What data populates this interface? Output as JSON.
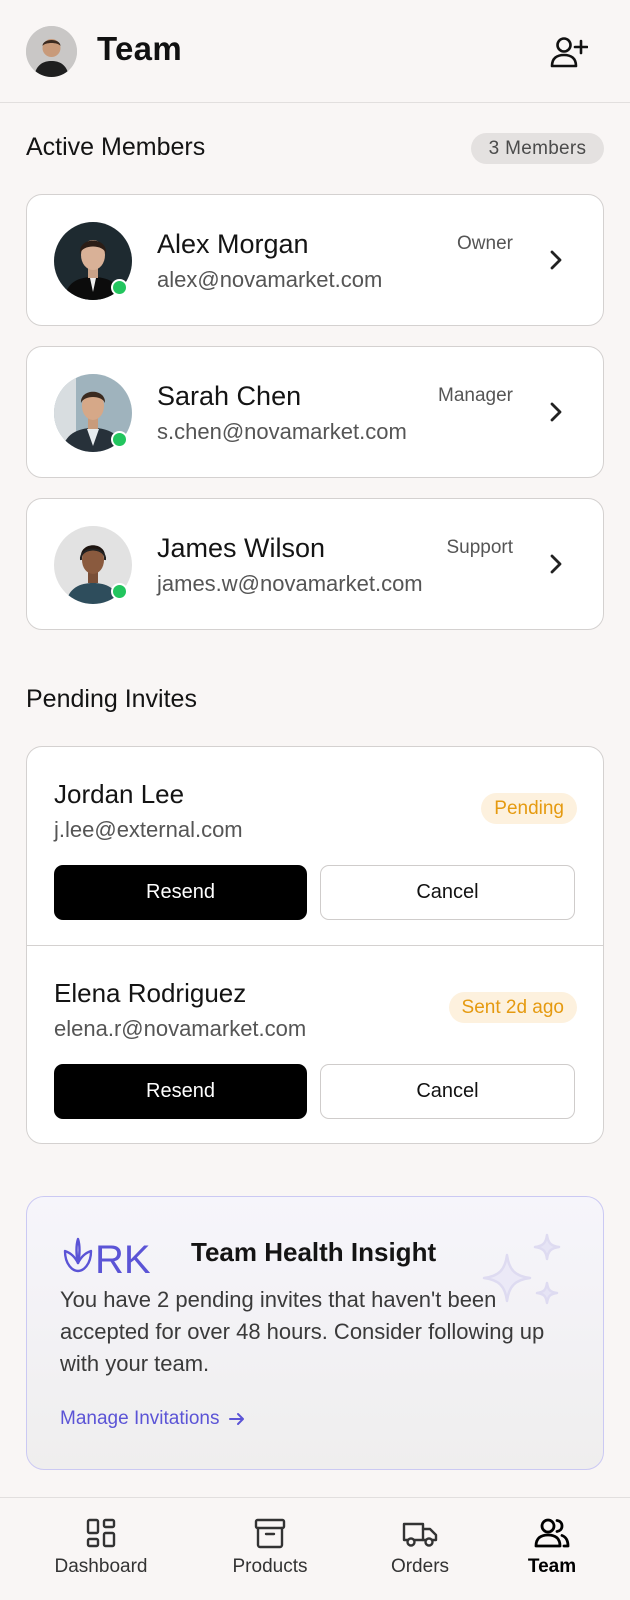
{
  "header": {
    "title": "Team",
    "avatar_icon": "user-avatar",
    "add_icon": "user-plus-icon"
  },
  "active_members": {
    "title": "Active Members",
    "count": "3 Members",
    "members": [
      {
        "name": "Alex Morgan",
        "email": "alex@novamarket.com",
        "role": "Owner",
        "status": "online"
      },
      {
        "name": "Sarah Chen",
        "email": "s.chen@novamarket.com",
        "role": "Manager",
        "status": "online"
      },
      {
        "name": "James Wilson",
        "email": "james.w@novamarket.com",
        "role": "Support",
        "status": "online"
      }
    ]
  },
  "pending_invites": {
    "title": "Pending Invites",
    "invites": [
      {
        "name": "Jordan Lee",
        "email": "j.lee@external.com",
        "status": "Pending",
        "resend_label": "Resend",
        "cancel_label": "Cancel"
      },
      {
        "name": "Elena Rodriguez",
        "email": "elena.r@novamarket.com",
        "status": "Sent 2d ago",
        "resend_label": "Resend",
        "cancel_label": "Cancel"
      }
    ]
  },
  "insight": {
    "title": "Team Health Insight",
    "body": "You have 2 pending invites that haven't been accepted for over 48 hours. Consider following up with your team.",
    "link_label": "Manage Invitations",
    "logo_text": "RK"
  },
  "nav": {
    "items": [
      {
        "label": "Dashboard",
        "icon": "dashboard-icon",
        "active": false
      },
      {
        "label": "Products",
        "icon": "archive-box-icon",
        "active": false
      },
      {
        "label": "Orders",
        "icon": "truck-icon",
        "active": false
      },
      {
        "label": "Team",
        "icon": "users-icon",
        "active": true
      }
    ]
  },
  "colors": {
    "online": "#22c55e",
    "pending_badge_text": "#e59a10",
    "pending_badge_bg": "#fdf1de",
    "accent": "#5b54d6"
  }
}
